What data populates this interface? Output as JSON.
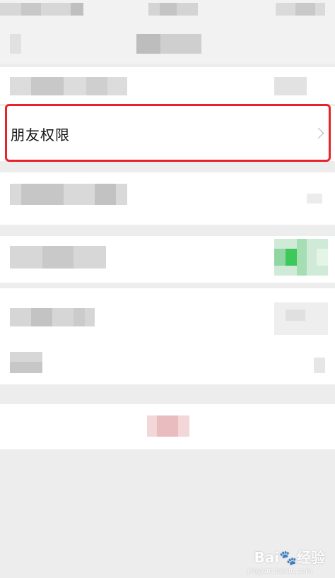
{
  "friend_permission_row": {
    "label": "朋友权限"
  },
  "watermark": {
    "brand": "Bai",
    "suffix": "经验",
    "domain": "jingyan.baidu.com"
  },
  "colors": {
    "highlight_border": "#e8232a",
    "toggle_on": "#3cc85a",
    "delete_text": "#e64340",
    "background": "#ededed"
  }
}
